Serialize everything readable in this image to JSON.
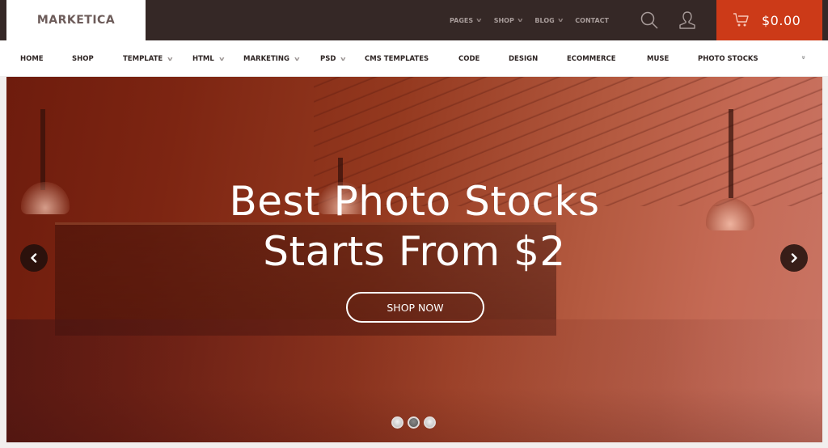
{
  "brand": {
    "name": "MARKETICA"
  },
  "top_menu": [
    {
      "label": "PAGES",
      "has_dropdown": true
    },
    {
      "label": "SHOP",
      "has_dropdown": true
    },
    {
      "label": "BLOG",
      "has_dropdown": true
    },
    {
      "label": "CONTACT",
      "has_dropdown": false
    }
  ],
  "icons": {
    "search": "search-icon",
    "account": "user-icon",
    "cart": "cart-icon"
  },
  "cart": {
    "total": "$0.00"
  },
  "main_nav": [
    {
      "label": "HOME",
      "has_dropdown": false
    },
    {
      "label": "SHOP",
      "has_dropdown": false
    },
    {
      "label": "TEMPLATE",
      "has_dropdown": true
    },
    {
      "label": "HTML",
      "has_dropdown": true
    },
    {
      "label": "MARKETING",
      "has_dropdown": true
    },
    {
      "label": "PSD",
      "has_dropdown": true
    },
    {
      "label": "CMS TEMPLATES",
      "has_dropdown": false
    },
    {
      "label": "CODE",
      "has_dropdown": false
    },
    {
      "label": "DESIGN",
      "has_dropdown": false
    },
    {
      "label": "ECOMMERCE",
      "has_dropdown": false
    },
    {
      "label": "MUSE",
      "has_dropdown": false
    },
    {
      "label": "PHOTO STOCKS",
      "has_dropdown": false
    }
  ],
  "main_nav_more": "»",
  "hero": {
    "title_line1": "Best Photo Stocks",
    "title_line2": "Starts From $2",
    "cta_label": "SHOP NOW",
    "slides_total": 3,
    "active_slide": 2
  },
  "colors": {
    "topbar": "#352826",
    "accent": "#cc3a18",
    "logo_text": "#6d5c5a",
    "nav_text": "#2d2423"
  }
}
